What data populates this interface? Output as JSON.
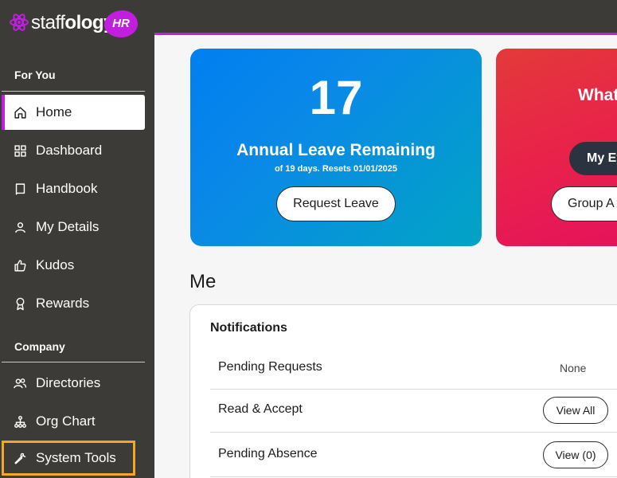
{
  "brand": {
    "name_light": "staff",
    "name_bold": "ology",
    "badge": "HR"
  },
  "sidebar": {
    "sections": [
      {
        "label": "For You"
      },
      {
        "label": "Company"
      }
    ],
    "items": [
      {
        "label": "Home",
        "icon": "home-icon"
      },
      {
        "label": "Dashboard",
        "icon": "grid-icon"
      },
      {
        "label": "Handbook",
        "icon": "book-icon"
      },
      {
        "label": "My Details",
        "icon": "user-icon"
      },
      {
        "label": "Kudos",
        "icon": "thumbs-up-icon"
      },
      {
        "label": "Rewards",
        "icon": "award-icon"
      },
      {
        "label": "Directories",
        "icon": "users-icon"
      },
      {
        "label": "Org Chart",
        "icon": "org-chart-icon"
      },
      {
        "label": "System Tools",
        "icon": "wrench-icon"
      }
    ]
  },
  "leave_card": {
    "days": "17",
    "title": "Annual Leave Remaining",
    "subtitle": "of 19 days. Resets 01/01/2025",
    "button": "Request Leave"
  },
  "events_card": {
    "title": "What",
    "dark_button": "My Ev",
    "outline_button": "Group A"
  },
  "me": {
    "heading": "Me",
    "notifications_title": "Notifications",
    "rows": [
      {
        "label": "Pending Requests",
        "value": "None"
      },
      {
        "label": "Read & Accept",
        "button": "View All"
      },
      {
        "label": "Pending Absence",
        "button": "View (0)"
      }
    ]
  },
  "colors": {
    "sidebar_bg": "#3c3b37",
    "accent": "#c21ee0",
    "highlight": "#f5a623"
  }
}
